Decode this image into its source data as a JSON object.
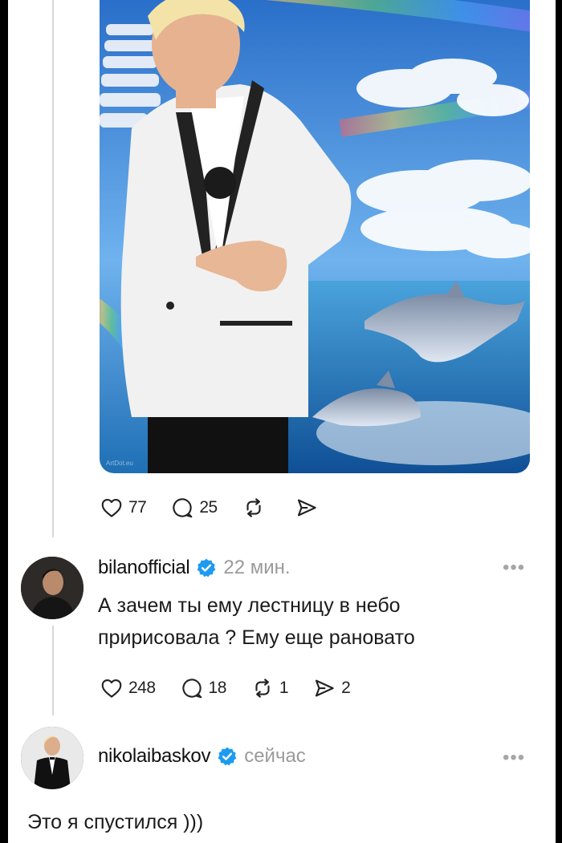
{
  "post": {
    "image_alt": "",
    "actions": {
      "likes": "77",
      "replies": "25",
      "reposts": "",
      "shares": ""
    }
  },
  "comments": [
    {
      "username": "bilanofficial",
      "verified": true,
      "time": "22 мин.",
      "text": "А зачем ты ему лестницу в небо пририсовала ? Ему еще рановато",
      "actions": {
        "likes": "248",
        "replies": "18",
        "reposts": "1",
        "shares": "2"
      }
    },
    {
      "username": "nikolaibaskov",
      "verified": true,
      "time": "сейчас",
      "text": "Это я спустился )))"
    }
  ],
  "menu": {
    "more_label": "•••"
  },
  "colors": {
    "verified": "#1d9bf0",
    "thread_line": "#d7d7d7",
    "muted": "#9a9a9a"
  },
  "icons": [
    "heart-icon",
    "comment-icon",
    "repost-icon",
    "share-icon",
    "verified-icon",
    "more-icon"
  ]
}
